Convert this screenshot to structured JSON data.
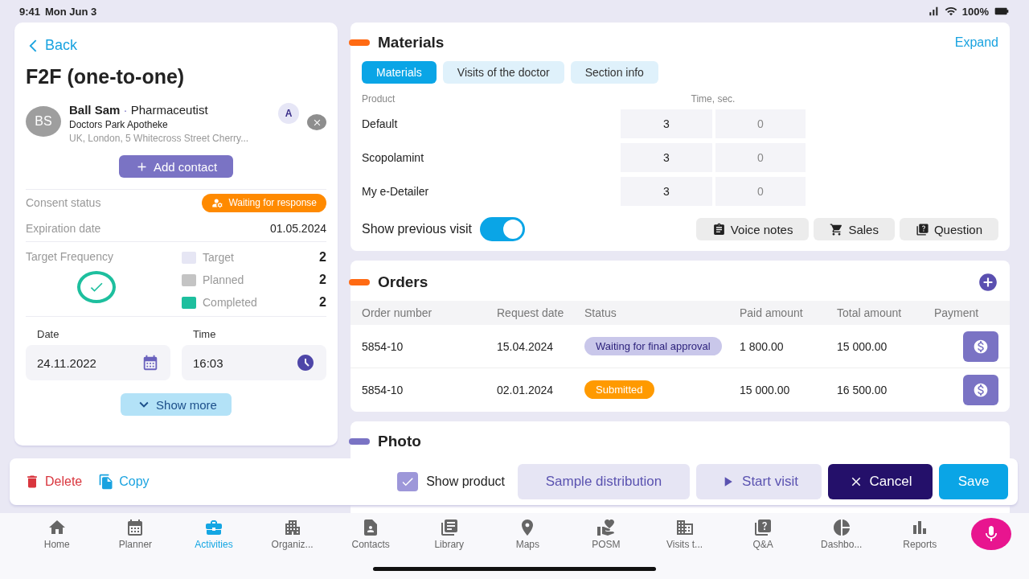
{
  "status_bar": {
    "time": "9:41",
    "date": "Mon Jun 3",
    "battery": "100%"
  },
  "visit": {
    "back": "Back",
    "title": "F2F (one-to-one)",
    "contact": {
      "initials": "BS",
      "name": "Ball Sam",
      "separator": "·",
      "role": "Pharmaceutist",
      "organization": "Doctors Park Apotheke",
      "address": "UK, London, 5 Whitecross Street Cherry...",
      "badge": "A"
    },
    "add_contact": "Add contact",
    "consent": {
      "label": "Consent status",
      "value": "Waiting for response"
    },
    "expiration": {
      "label": "Expiration date",
      "value": "01.05.2024"
    },
    "frequency": {
      "label": "Target Frequency",
      "legend": [
        {
          "label": "Target",
          "value": "2",
          "color": "#e6e6f4"
        },
        {
          "label": "Planned",
          "value": "2",
          "color": "#c4c4c4"
        },
        {
          "label": "Completed",
          "value": "2",
          "color": "#1dbf9e"
        }
      ]
    },
    "date": {
      "label": "Date",
      "value": "24.11.2022"
    },
    "time": {
      "label": "Time",
      "value": "16:03"
    },
    "show_more": "Show more"
  },
  "materials": {
    "title": "Materials",
    "expand": "Expand",
    "tabs": [
      {
        "label": "Materials",
        "selected": true
      },
      {
        "label": "Visits of the doctor",
        "selected": false
      },
      {
        "label": "Section info",
        "selected": false
      }
    ],
    "columns": [
      "Product",
      "Time, sec."
    ],
    "rows": [
      {
        "product": "Default",
        "values": [
          "3",
          "0"
        ]
      },
      {
        "product": "Scopolamint",
        "values": [
          "3",
          "0"
        ]
      },
      {
        "product": "My e-Detailer",
        "values": [
          "3",
          "0"
        ]
      }
    ],
    "show_previous_visit": {
      "label": "Show previous visit",
      "on": true
    },
    "actions": [
      {
        "kind": "voice",
        "label": "Voice notes"
      },
      {
        "kind": "sales",
        "label": "Sales"
      },
      {
        "kind": "question",
        "label": "Question"
      }
    ]
  },
  "orders": {
    "title": "Orders",
    "columns": [
      "Order number",
      "Request date",
      "Status",
      "Paid amount",
      "Total amount",
      "Payment"
    ],
    "rows": [
      {
        "number": "5854-10",
        "date": "15.04.2024",
        "status": {
          "kind": "approval",
          "label": "Waiting for final approval"
        },
        "paid": "1 800.00",
        "total": "15 000.00"
      },
      {
        "number": "5854-10",
        "date": "02.01.2024",
        "status": {
          "kind": "submitted",
          "label": "Submitted"
        },
        "paid": "15 000.00",
        "total": "16 500.00"
      }
    ]
  },
  "photo": {
    "title": "Photo"
  },
  "action_bar": {
    "delete": "Delete",
    "copy": "Copy",
    "show_product": {
      "label": "Show product",
      "checked": true
    },
    "buttons": [
      {
        "kind": "secondary",
        "label": "Sample distribution"
      },
      {
        "kind": "start",
        "label": "Start visit"
      },
      {
        "kind": "cancel",
        "label": "Cancel"
      },
      {
        "kind": "save",
        "label": "Save"
      }
    ]
  },
  "nav": [
    {
      "kind": "home",
      "label": "Home",
      "selected": false
    },
    {
      "kind": "planner",
      "label": "Planner",
      "selected": false
    },
    {
      "kind": "activities",
      "label": "Activities",
      "selected": true
    },
    {
      "kind": "organizations",
      "label": "Organiz...",
      "selected": false
    },
    {
      "kind": "contacts",
      "label": "Contacts",
      "selected": false
    },
    {
      "kind": "library",
      "label": "Library",
      "selected": false
    },
    {
      "kind": "maps",
      "label": "Maps",
      "selected": false
    },
    {
      "kind": "posm",
      "label": "POSM",
      "selected": false
    },
    {
      "kind": "visits",
      "label": "Visits t...",
      "selected": false
    },
    {
      "kind": "qa",
      "label": "Q&A",
      "selected": false
    },
    {
      "kind": "dashboard",
      "label": "Dashbo...",
      "selected": false
    },
    {
      "kind": "reports",
      "label": "Reports",
      "selected": false
    }
  ]
}
